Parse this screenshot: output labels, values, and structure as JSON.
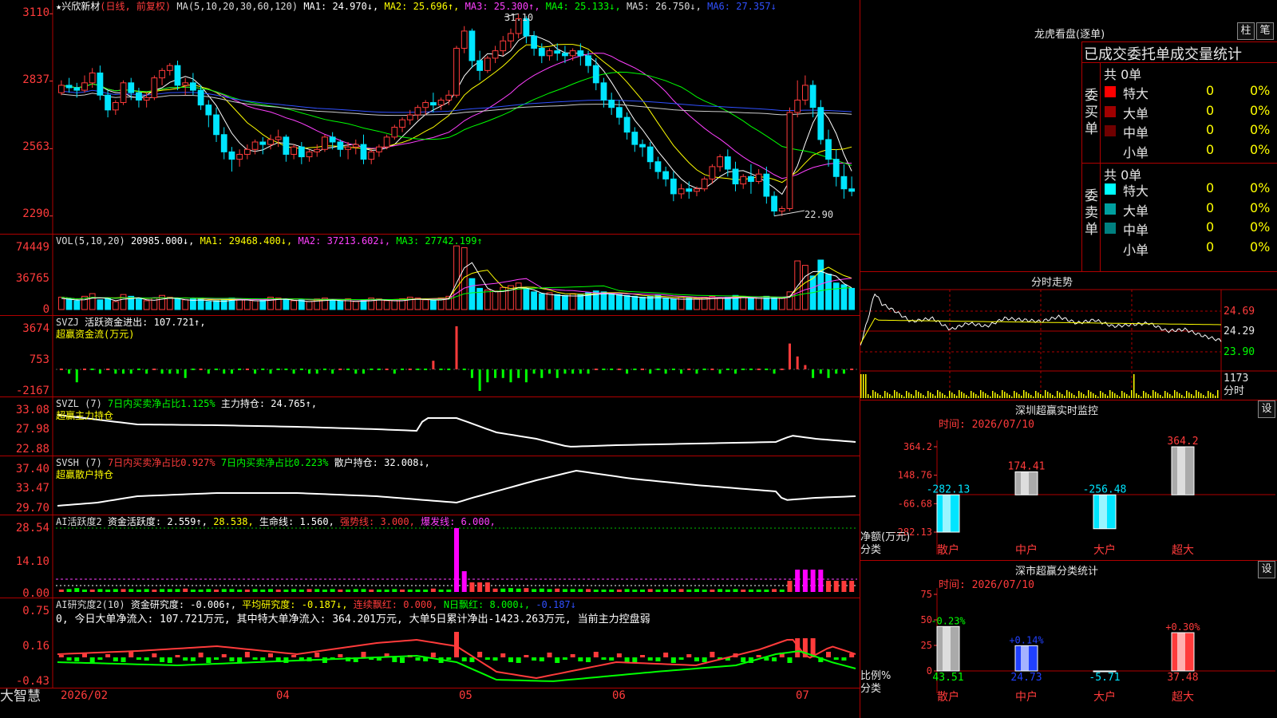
{
  "colors": {
    "up": "#ff3b3b",
    "down": "#00e5ff",
    "grid": "#b00000",
    "axis": "#ff3b3b",
    "yellow": "#ffff00",
    "magenta": "#ff40ff",
    "green": "#00ff00",
    "white": "#ffffff"
  },
  "kline": {
    "header": {
      "title": "★兴欣新材",
      "period": "(日线, 前复权)",
      "ma_def": "MA(5,10,20,30,60,120)",
      "ma1": "MA1: 24.970↓,",
      "ma2": "MA2: 25.696↑,",
      "ma3": "MA3: 25.300↑,",
      "ma4": "MA4: 25.133↓,",
      "ma5": "MA5: 26.750↓,",
      "ma6": "MA6: 27.357↓"
    },
    "y_ticks": [
      "3110",
      "2837",
      "2563",
      "2290"
    ],
    "high_marker": "31.10",
    "low_marker": "22.90",
    "candles": [
      [
        27.9,
        28.4,
        28.2,
        27.8
      ],
      [
        28.2,
        28.5,
        28.1,
        27.9
      ],
      [
        28.1,
        28.3,
        28.0,
        27.7
      ],
      [
        28.0,
        28.6,
        28.3,
        27.9
      ],
      [
        28.3,
        28.9,
        28.7,
        28.1
      ],
      [
        28.7,
        29.0,
        27.8,
        27.6
      ],
      [
        27.8,
        28.0,
        27.2,
        26.9
      ],
      [
        27.2,
        27.6,
        27.5,
        27.0
      ],
      [
        27.5,
        28.4,
        28.3,
        27.4
      ],
      [
        28.3,
        28.5,
        27.9,
        27.6
      ],
      [
        27.9,
        28.1,
        27.6,
        27.3
      ],
      [
        27.6,
        27.9,
        27.7,
        27.3
      ],
      [
        27.7,
        28.6,
        28.5,
        27.6
      ],
      [
        28.5,
        28.9,
        28.8,
        28.2
      ],
      [
        28.8,
        29.1,
        29.0,
        28.6
      ],
      [
        29.0,
        29.2,
        28.2,
        28.0
      ],
      [
        28.2,
        28.5,
        28.3,
        27.8
      ],
      [
        28.3,
        28.7,
        28.0,
        27.8
      ],
      [
        28.0,
        28.2,
        27.4,
        27.2
      ],
      [
        27.4,
        27.6,
        27.0,
        26.5
      ],
      [
        27.0,
        27.3,
        26.2,
        25.9
      ],
      [
        26.2,
        26.5,
        25.5,
        25.2
      ],
      [
        25.5,
        25.7,
        25.2,
        24.7
      ],
      [
        25.2,
        25.6,
        25.4,
        24.9
      ],
      [
        25.4,
        25.8,
        25.6,
        25.2
      ],
      [
        25.6,
        26.0,
        25.9,
        25.4
      ],
      [
        25.9,
        26.1,
        25.8,
        25.4
      ],
      [
        25.8,
        26.2,
        26.0,
        25.6
      ],
      [
        26.0,
        26.4,
        26.1,
        25.7
      ],
      [
        26.1,
        26.2,
        25.4,
        25.1
      ],
      [
        25.4,
        25.8,
        25.7,
        25.2
      ],
      [
        25.7,
        25.9,
        25.3,
        25.0
      ],
      [
        25.3,
        25.6,
        25.5,
        25.1
      ],
      [
        25.5,
        25.8,
        25.6,
        25.3
      ],
      [
        25.6,
        26.2,
        26.1,
        25.5
      ],
      [
        26.1,
        26.3,
        25.9,
        25.6
      ],
      [
        25.9,
        26.0,
        25.6,
        25.3
      ],
      [
        25.6,
        25.9,
        25.7,
        25.2
      ],
      [
        25.7,
        26.0,
        25.8,
        25.4
      ],
      [
        25.8,
        26.2,
        25.2,
        25.0
      ],
      [
        25.2,
        25.6,
        25.5,
        25.0
      ],
      [
        25.5,
        25.8,
        25.7,
        25.3
      ],
      [
        25.7,
        26.2,
        26.1,
        25.6
      ],
      [
        26.1,
        26.6,
        26.5,
        26.0
      ],
      [
        26.5,
        26.9,
        26.8,
        26.3
      ],
      [
        26.8,
        27.2,
        27.0,
        26.6
      ],
      [
        27.0,
        27.4,
        27.3,
        26.8
      ],
      [
        27.3,
        27.6,
        27.5,
        27.0
      ],
      [
        27.5,
        27.9,
        27.4,
        27.1
      ],
      [
        27.4,
        27.7,
        27.6,
        27.2
      ],
      [
        27.6,
        28.0,
        27.8,
        27.4
      ],
      [
        27.8,
        29.8,
        29.7,
        27.7
      ],
      [
        29.7,
        30.6,
        30.4,
        29.5
      ],
      [
        30.4,
        30.5,
        29.2,
        28.9
      ],
      [
        29.2,
        29.6,
        28.8,
        28.4
      ],
      [
        28.8,
        29.4,
        29.3,
        28.7
      ],
      [
        29.3,
        29.8,
        29.6,
        29.1
      ],
      [
        29.6,
        30.2,
        30.0,
        29.4
      ],
      [
        30.0,
        30.5,
        30.3,
        29.7
      ],
      [
        30.3,
        31.1,
        30.9,
        30.1
      ],
      [
        30.9,
        31.0,
        30.2,
        29.9
      ],
      [
        30.2,
        30.4,
        29.7,
        29.4
      ],
      [
        29.7,
        29.9,
        29.4,
        29.1
      ],
      [
        29.4,
        29.7,
        29.6,
        29.2
      ],
      [
        29.6,
        29.9,
        29.5,
        29.2
      ],
      [
        29.5,
        29.8,
        29.4,
        29.1
      ],
      [
        29.4,
        29.7,
        29.6,
        29.2
      ],
      [
        29.6,
        29.9,
        29.4,
        29.0
      ],
      [
        29.4,
        29.6,
        29.0,
        28.7
      ],
      [
        29.0,
        29.3,
        28.3,
        28.0
      ],
      [
        28.3,
        28.5,
        27.6,
        27.3
      ],
      [
        27.6,
        27.9,
        27.3,
        27.0
      ],
      [
        27.3,
        27.6,
        26.9,
        26.6
      ],
      [
        26.9,
        27.1,
        26.3,
        26.0
      ],
      [
        26.3,
        26.5,
        25.8,
        25.5
      ],
      [
        25.8,
        26.0,
        25.7,
        25.3
      ],
      [
        25.7,
        25.9,
        25.1,
        24.8
      ],
      [
        25.1,
        25.3,
        24.7,
        24.4
      ],
      [
        24.7,
        24.9,
        24.4,
        24.1
      ],
      [
        24.4,
        24.7,
        23.8,
        23.5
      ],
      [
        23.8,
        24.2,
        24.0,
        23.6
      ],
      [
        24.0,
        24.3,
        23.9,
        23.6
      ],
      [
        23.9,
        24.1,
        24.0,
        23.7
      ],
      [
        24.0,
        24.5,
        24.4,
        23.9
      ],
      [
        24.4,
        25.0,
        24.9,
        24.2
      ],
      [
        24.9,
        25.4,
        25.3,
        24.7
      ],
      [
        25.3,
        25.6,
        24.8,
        24.5
      ],
      [
        24.8,
        25.1,
        24.2,
        23.9
      ],
      [
        24.2,
        24.6,
        24.5,
        24.0
      ],
      [
        24.5,
        25.0,
        24.3,
        23.8
      ],
      [
        24.3,
        24.8,
        24.6,
        24.2
      ],
      [
        24.6,
        24.9,
        23.7,
        23.4
      ],
      [
        23.7,
        23.9,
        23.1,
        22.9
      ],
      [
        23.1,
        23.3,
        23.2,
        22.9
      ],
      [
        23.2,
        27.3,
        27.1,
        23.1
      ],
      [
        27.1,
        28.4,
        27.6,
        26.9
      ],
      [
        27.6,
        28.6,
        28.2,
        27.4
      ],
      [
        28.2,
        28.4,
        27.3,
        26.9
      ],
      [
        27.3,
        27.6,
        26.0,
        25.8
      ],
      [
        26.0,
        26.4,
        25.2,
        24.9
      ],
      [
        25.2,
        25.6,
        24.5,
        24.1
      ],
      [
        24.5,
        25.0,
        24.0,
        23.6
      ],
      [
        24.0,
        24.5,
        23.9,
        23.7
      ]
    ]
  },
  "vol": {
    "header": "VOL(5,10,20)",
    "val": "20985.000↓,",
    "ma1": "MA1: 29468.400↓,",
    "ma2": "MA2: 37213.602↓,",
    "ma3": "MA3: 27742.199↑",
    "y_ticks": [
      "74449",
      "36765",
      "0"
    ],
    "values": [
      14,
      12,
      10,
      15,
      18,
      11,
      13,
      9,
      17,
      15,
      12,
      10,
      13,
      16,
      14,
      12,
      11,
      12,
      13,
      9,
      10,
      12,
      13,
      11,
      12,
      10,
      11,
      14,
      13,
      12,
      10,
      11,
      9,
      12,
      13,
      11,
      10,
      12,
      9,
      11,
      13,
      12,
      10,
      11,
      12,
      14,
      13,
      11,
      12,
      13,
      15,
      72,
      70,
      35,
      24,
      22,
      21,
      25,
      27,
      30,
      24,
      20,
      18,
      19,
      17,
      16,
      18,
      17,
      19,
      21,
      20,
      18,
      17,
      16,
      15,
      14,
      15,
      16,
      13,
      12,
      14,
      13,
      12,
      14,
      15,
      13,
      14,
      16,
      15,
      13,
      14,
      15,
      14,
      13,
      20,
      55,
      50,
      38,
      56,
      40,
      30,
      28,
      24
    ]
  },
  "svzj": {
    "name": "SVZJ",
    "label1": "活跃资金进出: 107.721↑,",
    "label2": "超赢资金流(万元)",
    "y_ticks": [
      "3674",
      "753",
      "-2167"
    ],
    "values": [
      0,
      -1,
      -3,
      0,
      0,
      -1,
      0,
      -1,
      -1,
      -1,
      0,
      -1,
      0,
      -1,
      -1,
      -1,
      -2,
      0,
      0,
      -1,
      0,
      -1,
      -1,
      0,
      0,
      -1,
      0,
      -1,
      0,
      0,
      -1,
      0,
      -1,
      -1,
      0,
      -1,
      0,
      0,
      -1,
      -1,
      0,
      0,
      0,
      -1,
      0,
      0,
      0,
      0,
      2,
      0,
      0,
      10,
      0,
      -2,
      -5,
      -3,
      -2,
      -2,
      -3,
      -2,
      -3,
      -1,
      -2,
      -1,
      -2,
      -1,
      -1,
      -1,
      -1,
      0,
      0,
      0,
      0,
      -1,
      0,
      0,
      -1,
      0,
      -1,
      0,
      -1,
      0,
      -1,
      0,
      0,
      -1,
      0,
      -1,
      0,
      0,
      0,
      0,
      -1,
      0,
      6,
      3,
      1,
      -2,
      -1,
      -2,
      -1,
      -1,
      0
    ]
  },
  "svzl": {
    "name": "SVZL (7)",
    "label1": "7日内买卖净占比1.125%",
    "label2": "主力持仓: 24.765↑,",
    "label3": "超赢主力持仓",
    "y_ticks": [
      "33.08",
      "27.98",
      "22.88"
    ]
  },
  "svsh": {
    "name": "SVSH (7)",
    "label1": "7日内买卖净占比0.927%",
    "label2": "7日内买卖净占比0.223%",
    "label3": "散户持仓: 32.008↓,",
    "label4": "超赢散户持仓",
    "y_ticks": [
      "37.40",
      "33.47",
      "29.70"
    ]
  },
  "ai1": {
    "name": "AI活跃度2",
    "label1": "资金活跃度: 2.559↑,",
    "label2": "28.538,",
    "label3": "生命线: 1.560,",
    "label4": "强势线: 3.000,",
    "label5": "爆发线: 6.000,",
    "y_ticks": [
      "28.54",
      "14.10",
      "0.00"
    ]
  },
  "ai2": {
    "name": "AI研究度2(10)",
    "label1": "资金研究度: -0.006↑,",
    "label2": "平均研究度: -0.187↓,",
    "label3": "连续飘红: 0.000,",
    "label4": "N日飘红: 8.000↓,",
    "label5": "-0.187↓",
    "label6": "0, 今日大单净流入: 107.721万元, 其中特大单净流入: 364.201万元, 大单5日累计净出-1423.263万元, 当前主力控盘弱",
    "y_ticks": [
      "0.75",
      "0.16",
      "-0.43"
    ]
  },
  "xaxis": {
    "labels": [
      "2026/02",
      "04",
      "05",
      "06",
      "07"
    ]
  },
  "brand": "大智慧",
  "longhu": {
    "title": "龙虎看盘(逐单)",
    "btn1": "柱",
    "btn2": "笔",
    "subtitle": "已成交委托单成交量统计",
    "buy": {
      "side": "委买单",
      "total": "共 0单",
      "rows": [
        {
          "label": "特大",
          "count": "0",
          "pct": "0%",
          "color": "#ff0000"
        },
        {
          "label": "大单",
          "count": "0",
          "pct": "0%",
          "color": "#a00000"
        },
        {
          "label": "中单",
          "count": "0",
          "pct": "0%",
          "color": "#700000"
        },
        {
          "label": "小单",
          "count": "0",
          "pct": "0%",
          "color": "#000000"
        }
      ]
    },
    "sell": {
      "side": "委卖单",
      "total": "共 0单",
      "rows": [
        {
          "label": "特大",
          "count": "0",
          "pct": "0%",
          "color": "#00ffff"
        },
        {
          "label": "大单",
          "count": "0",
          "pct": "0%",
          "color": "#00a0a0"
        },
        {
          "label": "中单",
          "count": "0",
          "pct": "0%",
          "color": "#008080"
        },
        {
          "label": "小单",
          "count": "0",
          "pct": "0%",
          "color": "#000000"
        }
      ]
    }
  },
  "intraday": {
    "title": "分时走势",
    "y_ticks": [
      "24.69",
      "24.29",
      "23.90"
    ],
    "vol_tick": "1173",
    "vol_label": "分时"
  },
  "monitor": {
    "title": "深圳超赢实时监控",
    "btn": "设",
    "time": "时间: 2026/07/10",
    "y_ticks": [
      "364.2",
      "148.76",
      "-66.68",
      "-282.13"
    ],
    "axis_label1": "净额(万元)",
    "axis_label2": "分类",
    "chart_data": {
      "type": "bar",
      "categories": [
        "散户",
        "中户",
        "大户",
        "超大"
      ],
      "values": [
        -282.13,
        174.41,
        -256.48,
        364.2
      ],
      "value_labels": [
        "-282.13",
        "174.41",
        "-256.48",
        "364.2"
      ],
      "ylim": [
        -282.13,
        364.2
      ]
    }
  },
  "classify": {
    "title": "深市超赢分类统计",
    "btn": "设",
    "time": "时间: 2026/07/10",
    "y_ticks": [
      "75",
      "50",
      "25",
      "0"
    ],
    "axis_label1": "比例%",
    "axis_label2": "分类",
    "chart_data": {
      "type": "bar",
      "categories": [
        "散户",
        "中户",
        "大户",
        "超大"
      ],
      "values": [
        43.51,
        24.73,
        -5.71,
        37.48
      ],
      "changes": [
        "-0.23%",
        "+0.14%",
        "",
        "+0.30%"
      ],
      "value_labels": [
        "43.51",
        "24.73",
        "-5.71",
        "37.48"
      ],
      "ylim": [
        0,
        75
      ]
    }
  }
}
